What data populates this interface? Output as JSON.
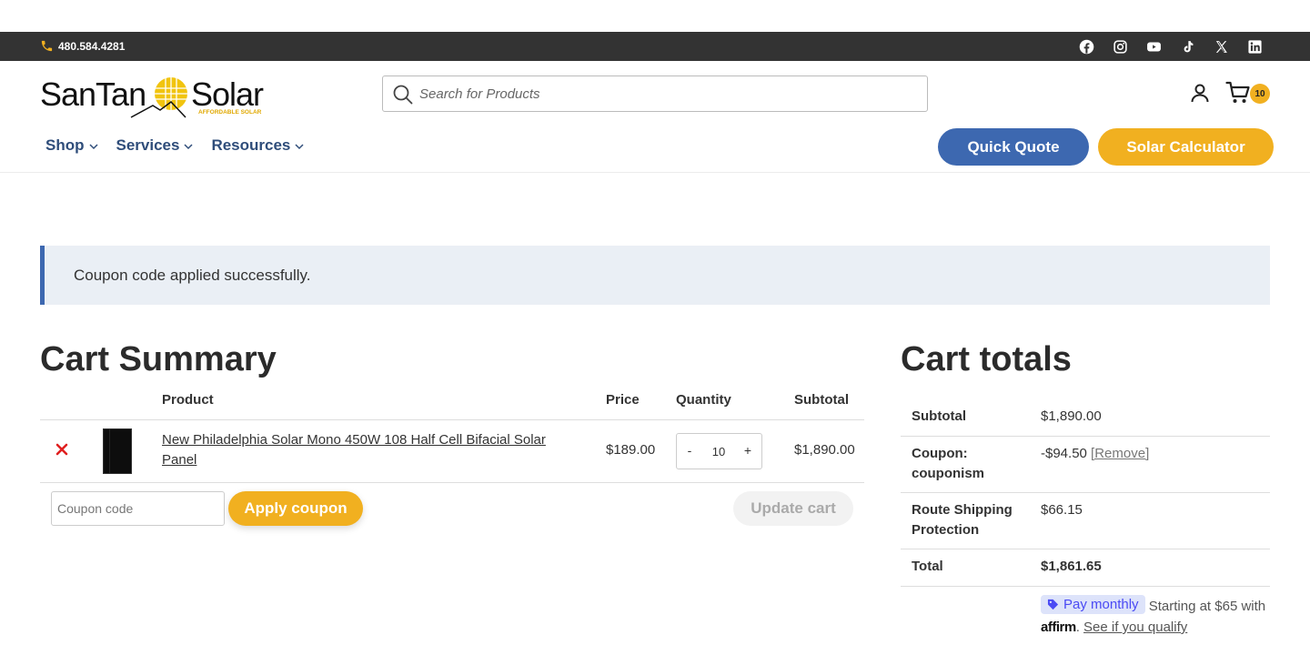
{
  "topbar": {
    "phone": "480.584.4281",
    "social_icons": [
      "facebook-icon",
      "instagram-icon",
      "youtube-icon",
      "tiktok-icon",
      "x-icon",
      "linkedin-icon"
    ]
  },
  "header": {
    "logo_text": "SanTan Solar",
    "logo_tagline": "AFFORDABLE SOLAR",
    "search_placeholder": "Search for Products",
    "cart_count": "10"
  },
  "nav": {
    "items": [
      {
        "label": "Shop"
      },
      {
        "label": "Services"
      },
      {
        "label": "Resources"
      }
    ],
    "quick_quote": "Quick Quote",
    "solar_calculator": "Solar Calculator"
  },
  "notice": "Coupon code applied successfully.",
  "cart": {
    "title": "Cart Summary",
    "columns": {
      "product": "Product",
      "price": "Price",
      "quantity": "Quantity",
      "subtotal": "Subtotal"
    },
    "items": [
      {
        "name": "New Philadelphia Solar Mono 450W 108 Half Cell Bifacial Solar Panel",
        "price": "$189.00",
        "quantity": "10",
        "subtotal": "$1,890.00"
      }
    ],
    "qty_minus": "-",
    "qty_plus": "+",
    "coupon_placeholder": "Coupon code",
    "apply_coupon": "Apply coupon",
    "update_cart": "Update cart"
  },
  "totals": {
    "title": "Cart totals",
    "subtotal_label": "Subtotal",
    "subtotal_value": "$1,890.00",
    "coupon_label": "Coupon: couponism",
    "coupon_value": "-$94.50",
    "coupon_remove": "[Remove]",
    "shipping_label": "Route Shipping Protection",
    "shipping_value": "$66.15",
    "total_label": "Total",
    "total_value": "$1,861.65",
    "affirm_badge": "Pay monthly",
    "affirm_text": "Starting at $65 with",
    "affirm_logo": "affirm",
    "affirm_link": "See if you qualify"
  },
  "colors": {
    "brand_blue": "#2f4d7a",
    "accent_blue": "#3d68b0",
    "accent_yellow": "#f1b020",
    "topbar": "#333333",
    "remove_red": "#e02020"
  }
}
